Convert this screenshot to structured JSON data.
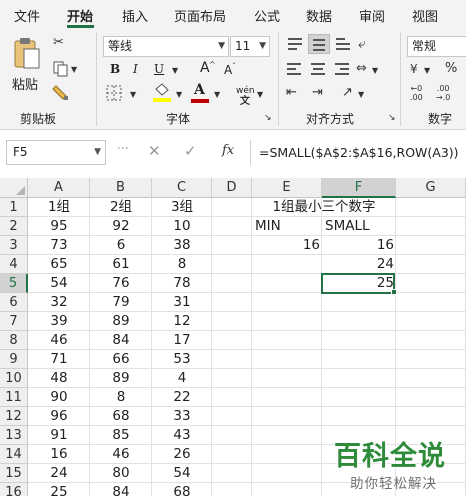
{
  "tabs": [
    {
      "label": "文件",
      "active": false
    },
    {
      "label": "开始",
      "active": true
    },
    {
      "label": "插入",
      "active": false
    },
    {
      "label": "页面布局",
      "active": false
    },
    {
      "label": "公式",
      "active": false
    },
    {
      "label": "数据",
      "active": false
    },
    {
      "label": "审阅",
      "active": false
    },
    {
      "label": "视图",
      "active": false
    }
  ],
  "ribbon": {
    "clipboard": {
      "paste_label": "粘贴",
      "group_label": "剪贴板"
    },
    "font": {
      "font_name": "等线",
      "font_size": "11",
      "bold": "B",
      "italic": "I",
      "underline": "U",
      "grow": "A",
      "shrink": "A",
      "phonetic": "wén",
      "group_label": "字体"
    },
    "alignment": {
      "group_label": "对齐方式"
    },
    "number": {
      "format": "常规",
      "group_label": "数字"
    }
  },
  "formula_bar": {
    "name_box": "F5",
    "fx_label": "fx",
    "formula": "=SMALL($A$2:$A$16,ROW(A3))"
  },
  "sheet": {
    "columns": [
      "A",
      "B",
      "C",
      "D",
      "E",
      "F",
      "G"
    ],
    "active_column": "F",
    "active_row": "5",
    "rows": [
      {
        "num": "1",
        "A": "1组",
        "B": "2组",
        "C": "3组",
        "E": "1组最小三个数字"
      },
      {
        "num": "2",
        "A": "95",
        "B": "92",
        "C": "10",
        "E": "MIN",
        "F": "SMALL"
      },
      {
        "num": "3",
        "A": "73",
        "B": "6",
        "C": "38",
        "E": "16",
        "F": "16"
      },
      {
        "num": "4",
        "A": "65",
        "B": "61",
        "C": "8",
        "F": "24"
      },
      {
        "num": "5",
        "A": "54",
        "B": "76",
        "C": "78",
        "F": "25"
      },
      {
        "num": "6",
        "A": "32",
        "B": "79",
        "C": "31"
      },
      {
        "num": "7",
        "A": "39",
        "B": "89",
        "C": "12"
      },
      {
        "num": "8",
        "A": "46",
        "B": "84",
        "C": "17"
      },
      {
        "num": "9",
        "A": "71",
        "B": "66",
        "C": "53"
      },
      {
        "num": "10",
        "A": "48",
        "B": "89",
        "C": "4"
      },
      {
        "num": "11",
        "A": "90",
        "B": "8",
        "C": "22"
      },
      {
        "num": "12",
        "A": "96",
        "B": "68",
        "C": "33"
      },
      {
        "num": "13",
        "A": "91",
        "B": "85",
        "C": "43"
      },
      {
        "num": "14",
        "A": "16",
        "B": "46",
        "C": "26"
      },
      {
        "num": "15",
        "A": "24",
        "B": "80",
        "C": "54"
      },
      {
        "num": "16",
        "A": "25",
        "B": "84",
        "C": "68"
      }
    ]
  },
  "watermark": {
    "logo": "百科全说",
    "subtitle": "助你轻松解决"
  },
  "colors": {
    "accent": "#217346",
    "watermark_green": "#2e8b3a",
    "highlight_yellow": "#ffff00",
    "font_red": "#c00000"
  }
}
